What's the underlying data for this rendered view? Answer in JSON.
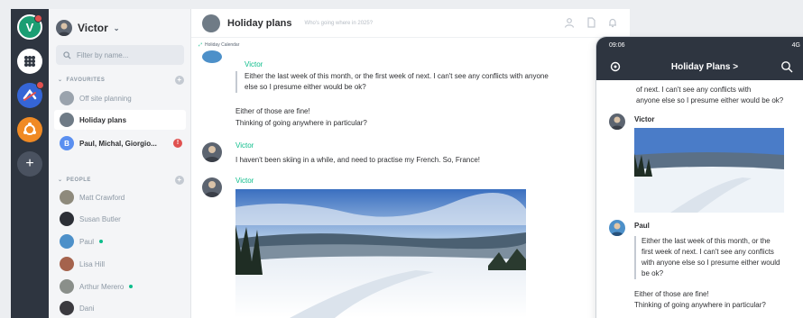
{
  "rail": {
    "user_initial": "V",
    "colors": {
      "rail_bg": "#2e3540",
      "user_avatar": "#1b9e73",
      "badge": "#e0514f"
    },
    "items": [
      {
        "name": "user",
        "icon": "user-initial-avatar",
        "badge": true
      },
      {
        "name": "community-1",
        "icon": "pattern-icon",
        "badge": false
      },
      {
        "name": "community-2",
        "icon": "matrix-logo-icon",
        "badge": true
      },
      {
        "name": "community-3",
        "icon": "ubuntu-logo-icon",
        "badge": false
      },
      {
        "name": "add",
        "icon": "plus-icon",
        "badge": false
      }
    ],
    "add_label": "+"
  },
  "roomlist": {
    "user_name": "Victor",
    "filter_placeholder": "Filter by name...",
    "favourites_label": "FAVOURITES",
    "people_label": "PEOPLE",
    "favourites": [
      {
        "name": "Off site planning",
        "state": "muted"
      },
      {
        "name": "Holiday plans",
        "state": "active"
      },
      {
        "name": "Paul, Michal, Giorgio...",
        "state": "bold",
        "initial": "B",
        "unread": "!"
      }
    ],
    "people": [
      {
        "name": "Matt Crawford",
        "online": false
      },
      {
        "name": "Susan Butler",
        "online": false
      },
      {
        "name": "Paul",
        "online": true
      },
      {
        "name": "Lisa Hill",
        "online": false
      },
      {
        "name": "Arthur Merero",
        "online": true
      },
      {
        "name": "Dani",
        "online": false
      }
    ]
  },
  "main": {
    "room_title": "Holiday plans",
    "room_topic": "Who's going where in 2025?",
    "widget_label": "Holiday Calendar",
    "messages": [
      {
        "sender": "Victor",
        "quote": [
          "Either the last week of this month, or the first week of next. I can't see any conflicts with anyone",
          "else so I presume either would be ok?"
        ]
      },
      {
        "sender": "",
        "lines": [
          "Either of those are fine!",
          "Thinking of going anywhere in particular?"
        ]
      },
      {
        "sender": "Victor",
        "lines": [
          "I haven't been skiing in a while, and need to practise my French. So, France!"
        ]
      },
      {
        "sender": "Victor",
        "image": "snowy-ski-slope-photo"
      }
    ]
  },
  "phone": {
    "time": "09:06",
    "signal": "4G",
    "title": "Holiday Plans >",
    "top_lines": [
      "of next. I can't see any conflicts with",
      "anyone else so I presume either would be ok?"
    ],
    "messages": [
      {
        "sender": "Victor",
        "image": "snowy-ski-slope-photo"
      },
      {
        "sender": "Paul",
        "quote": [
          "Either the last week of this month, or the",
          "first week of next. I can't see any conflicts",
          "with anyone else so I presume either would",
          "be ok?"
        ],
        "lines": [
          "Either of those are fine!",
          "Thinking of going anywhere in particular?"
        ]
      }
    ]
  }
}
